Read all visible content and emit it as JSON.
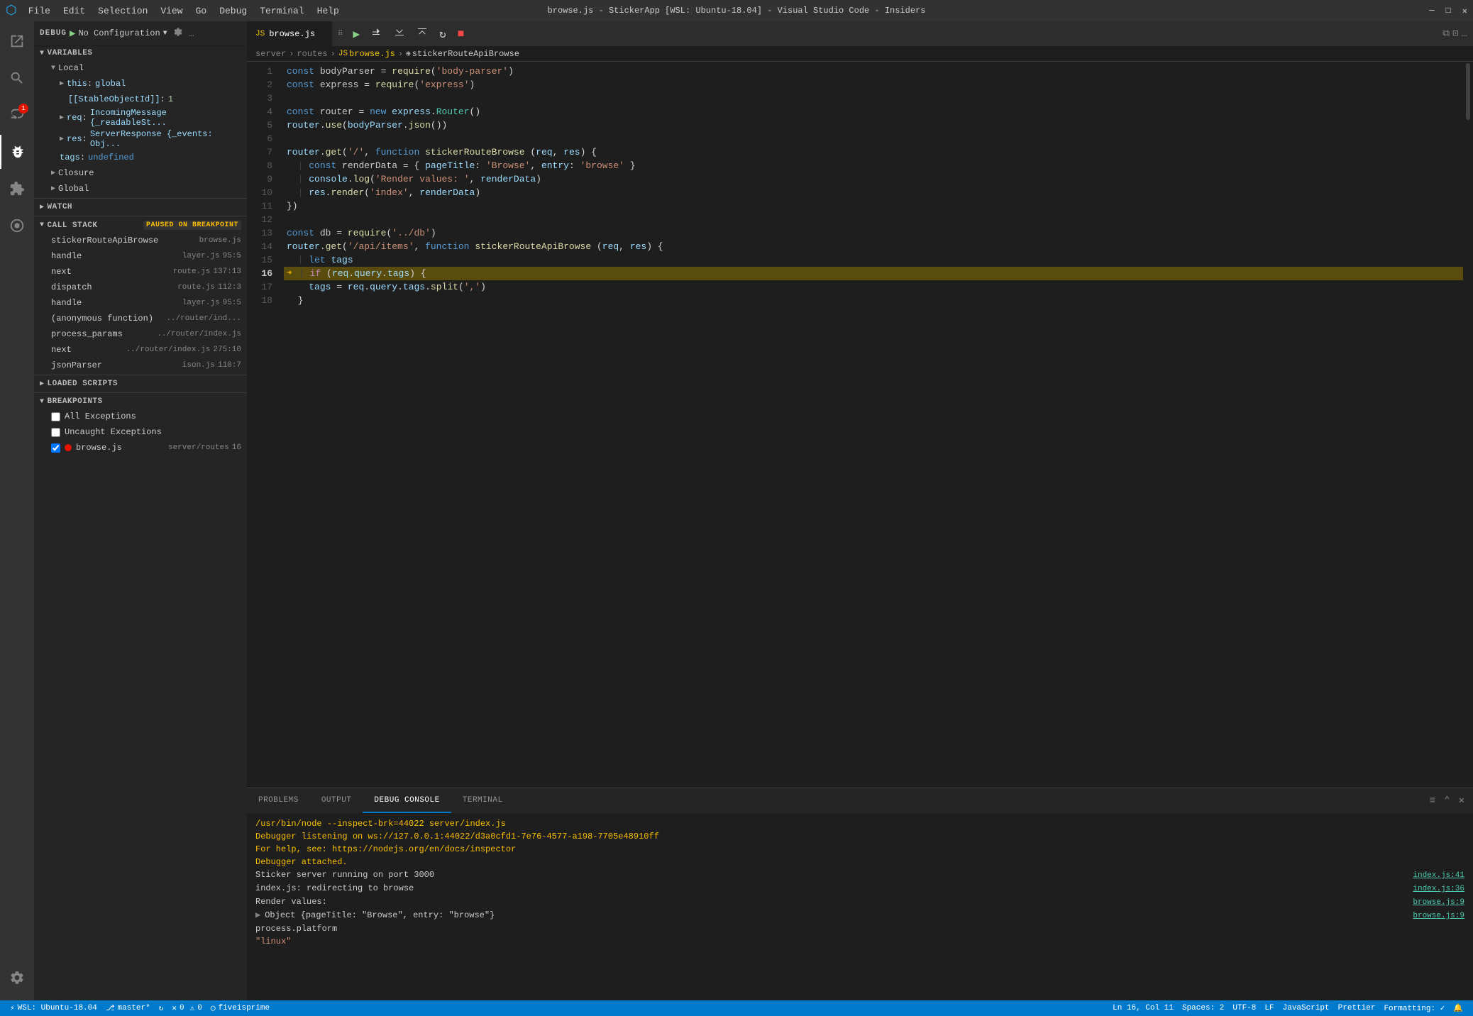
{
  "titleBar": {
    "title": "browse.js - StickerApp [WSL: Ubuntu-18.04] - Visual Studio Code - Insiders",
    "menuItems": [
      "File",
      "Edit",
      "Selection",
      "View",
      "Go",
      "Debug",
      "Terminal",
      "Help"
    ]
  },
  "debugToolbar": {
    "label": "DEBUG",
    "config": "No Configuration",
    "actions": [
      "continue",
      "step-over",
      "step-into",
      "step-out",
      "restart",
      "stop"
    ]
  },
  "variables": {
    "header": "VARIABLES",
    "local": {
      "label": "Local",
      "items": [
        {
          "name": "this",
          "value": "global",
          "indent": 2,
          "expandable": true
        },
        {
          "name": "[[StableObjectId]]",
          "value": "1",
          "indent": 3
        },
        {
          "name": "req",
          "value": "IncomingMessage {_readableSt...",
          "indent": 2,
          "expandable": true
        },
        {
          "name": "res",
          "value": "ServerResponse {_events: Obj...",
          "indent": 2,
          "expandable": true
        },
        {
          "name": "tags",
          "value": "undefined",
          "indent": 2
        }
      ]
    },
    "closure": {
      "label": "Closure",
      "expandable": true
    },
    "global": {
      "label": "Global",
      "expandable": true
    }
  },
  "watch": {
    "header": "WATCH"
  },
  "callStack": {
    "header": "CALL STACK",
    "badge": "PAUSED ON BREAKPOINT",
    "items": [
      {
        "fn": "stickerRouteApiBrowse",
        "file": "browse.js",
        "line": ""
      },
      {
        "fn": "handle",
        "file": "layer.js",
        "line": "95:5"
      },
      {
        "fn": "next",
        "file": "route.js",
        "line": "137:13"
      },
      {
        "fn": "dispatch",
        "file": "route.js",
        "line": "112:3"
      },
      {
        "fn": "handle",
        "file": "layer.js",
        "line": "95:5"
      },
      {
        "fn": "(anonymous function)",
        "file": "../router/ind...",
        "line": ""
      },
      {
        "fn": "process_params",
        "file": "../router/index.js",
        "line": ""
      },
      {
        "fn": "next",
        "file": "../router/index.js",
        "line": "275:10"
      },
      {
        "fn": "jsonParser",
        "file": "ison.js",
        "line": "110:7"
      }
    ]
  },
  "loadedScripts": {
    "header": "LOADED SCRIPTS"
  },
  "breakpoints": {
    "header": "BREAKPOINTS",
    "items": [
      {
        "label": "All Exceptions",
        "checked": false,
        "dot": false
      },
      {
        "label": "Uncaught Exceptions",
        "checked": false,
        "dot": false
      },
      {
        "label": "browse.js",
        "path": "server/routes",
        "line": "16",
        "checked": true,
        "dot": true
      }
    ]
  },
  "editorTab": {
    "filename": "browse.js",
    "icon": "JS"
  },
  "breadcrumb": {
    "parts": [
      "server",
      "routes",
      "browse.js",
      "stickerRouteApiBrowse"
    ]
  },
  "code": {
    "lines": [
      {
        "num": 1,
        "text": "const bodyParser = require('body-parser')",
        "tokens": [
          {
            "t": "const",
            "c": "kw"
          },
          {
            "t": " bodyParser "
          },
          {
            "t": "="
          },
          {
            "t": " require"
          },
          {
            "t": "("
          },
          {
            "t": "'body-parser'",
            "c": "str"
          },
          {
            "t": ")"
          }
        ]
      },
      {
        "num": 2,
        "text": "const express = require('express')",
        "tokens": [
          {
            "t": "const",
            "c": "kw"
          },
          {
            "t": " express "
          },
          {
            "t": "="
          },
          {
            "t": " require"
          },
          {
            "t": "("
          },
          {
            "t": "'express'",
            "c": "str"
          },
          {
            "t": ")"
          }
        ]
      },
      {
        "num": 3,
        "text": ""
      },
      {
        "num": 4,
        "text": "const router = new express.Router()"
      },
      {
        "num": 5,
        "text": "router.use(bodyParser.json())"
      },
      {
        "num": 6,
        "text": ""
      },
      {
        "num": 7,
        "text": "router.get('/', function stickerRouteBrowse (req, res) {"
      },
      {
        "num": 8,
        "text": "  const renderData = { pageTitle: 'Browse', entry: 'browse' }"
      },
      {
        "num": 9,
        "text": "  console.log('Render values: ', renderData)"
      },
      {
        "num": 10,
        "text": "  res.render('index', renderData)"
      },
      {
        "num": 11,
        "text": "})"
      },
      {
        "num": 12,
        "text": ""
      },
      {
        "num": 13,
        "text": "const db = require('../db')"
      },
      {
        "num": 14,
        "text": "router.get('/api/items', function stickerRouteApiBrowse (req, res) {"
      },
      {
        "num": 15,
        "text": "  let tags"
      },
      {
        "num": 16,
        "text": "  if (req.query.tags) {",
        "highlighted": true,
        "breakpoint": true,
        "debugArrow": true
      },
      {
        "num": 17,
        "text": "    tags = req.query.tags.split(',')"
      },
      {
        "num": 18,
        "text": "  }"
      }
    ]
  },
  "panelTabs": {
    "items": [
      "PROBLEMS",
      "OUTPUT",
      "DEBUG CONSOLE",
      "TERMINAL"
    ],
    "active": "DEBUG CONSOLE"
  },
  "consoleOutput": {
    "lines": [
      {
        "text": "/usr/bin/node --inspect-brk=44022 server/index.js",
        "color": "yellow",
        "source": ""
      },
      {
        "text": "Debugger listening on ws://127.0.0.1:44022/d3a0cfd1-7e76-4577-a198-7705e48910ff",
        "color": "yellow",
        "source": ""
      },
      {
        "text": "For help, see: https://nodejs.org/en/docs/inspector",
        "color": "yellow",
        "source": ""
      },
      {
        "text": "Debugger attached.",
        "color": "yellow",
        "source": ""
      },
      {
        "text": "Sticker server running on port 3000",
        "color": "normal",
        "source": "index.js:41"
      },
      {
        "text": "index.js: redirecting to browse",
        "color": "normal",
        "source": "index.js:36"
      },
      {
        "text": "Render values: ",
        "color": "normal",
        "source": "browse.js:9"
      },
      {
        "text": "> Object {pageTitle: \"Browse\", entry: \"browse\"}",
        "color": "normal",
        "source": "browse.js:9",
        "arrow": true
      },
      {
        "text": "process.platform",
        "color": "normal",
        "source": ""
      },
      {
        "text": "\"linux\"",
        "color": "str",
        "source": ""
      }
    ]
  },
  "statusBar": {
    "wsl": "WSL: Ubuntu-18.04",
    "branch": "master*",
    "sync": "",
    "errors": "0",
    "warnings": "0",
    "github": "fiveisprime",
    "ln": "Ln 16, Col 11",
    "spaces": "Spaces: 2",
    "encoding": "UTF-8",
    "eol": "LF",
    "language": "JavaScript",
    "prettier": "Prettier",
    "formatting": "Formatting: ✓",
    "bell": "🔔"
  }
}
